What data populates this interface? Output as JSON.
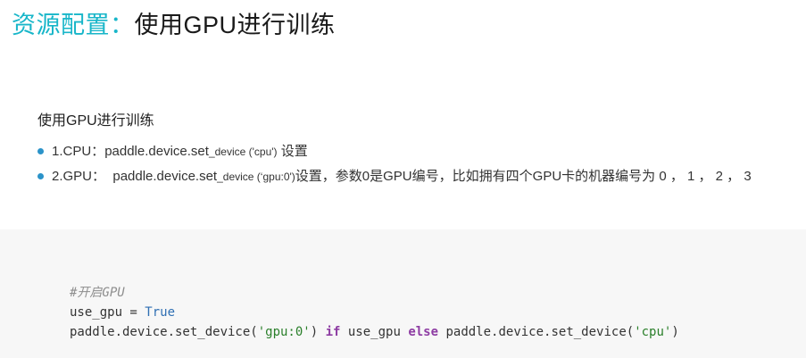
{
  "title": {
    "prefix": "资源配置",
    "separator": "：",
    "main": "使用GPU进行训练"
  },
  "section": {
    "heading": "使用GPU进行训练"
  },
  "bullets": [
    {
      "label": "1.CPU：",
      "code_pre": "paddle.device.set",
      "code_small": "_device ('cpu')",
      "suffix": " 设置"
    },
    {
      "label": "2.GPU：",
      "code_pre": "  paddle.device.set",
      "code_small": "_device (‘gpu:0')",
      "suffix": "设置，参数0是GPU编号，比如拥有四个GPU卡的机器编号为 0 ， 1 ， 2 ， 3"
    }
  ],
  "code": {
    "comment": "#开启GPU",
    "line2_pre": "use_gpu = ",
    "line2_true": "True",
    "line3_part1": "paddle.device.set_device(",
    "line3_str1": "'gpu:0'",
    "line3_part2": ") ",
    "line3_if": "if",
    "line3_part3": " use_gpu ",
    "line3_else": "else",
    "line3_part4": " paddle.device.set_device(",
    "line3_str2": "'cpu'",
    "line3_part5": ")"
  },
  "colors": {
    "title_accent": "#18b6c9",
    "bullet_dot": "#2b93c9",
    "code_background": "#f7f7f7",
    "keyword": "#8e3da3",
    "boolean": "#2f6fb3",
    "string": "#2a7f2a",
    "comment": "#8e8e8e"
  },
  "icons": {
    "bullet": "bullet-dot-icon"
  }
}
